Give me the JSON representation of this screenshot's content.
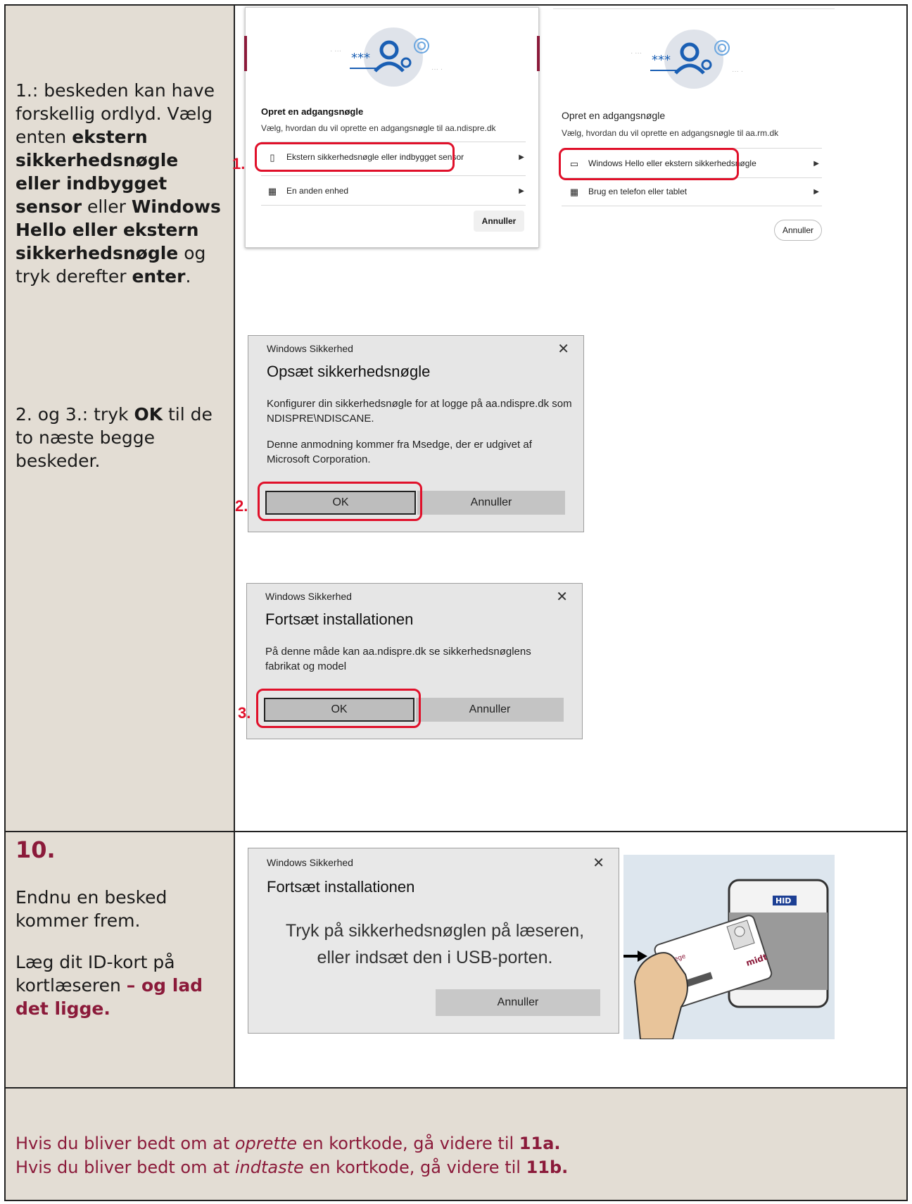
{
  "row1": {
    "left_text": {
      "p1": "1.: beskeden kan have forskellig ordlyd. Vælg enten ",
      "b1": "ekstern sikkerhedsnøgle eller indbygget sensor",
      "p2": " eller ",
      "b2": "Windows Hello eller ekstern sikkerhedsnøgle",
      "p3": " og tryk derefter ",
      "b3": "enter",
      "p4": "."
    },
    "left_text2": {
      "p1": "2. og 3.: tryk ",
      "b1": "OK",
      "p2": " til de to næste begge beskeder."
    },
    "passkey_a": {
      "title": "Opret en adgangsnøgle",
      "subtitle": "Vælg, hvordan du vil oprette en adgangsnøgle til aa.ndispre.dk",
      "option1": "Ekstern sikkerhedsnøgle eller indbygget sensor",
      "option2": "En anden enhed",
      "cancel": "Annuller",
      "marker": "1."
    },
    "passkey_b": {
      "title": "Opret en adgangsnøgle",
      "subtitle": "Vælg, hvordan du vil oprette en adgangsnøgle til aa.rm.dk",
      "option1": "Windows Hello eller ekstern sikkerhedsnøgle",
      "option2": "Brug en telefon eller tablet",
      "cancel": "Annuller"
    },
    "dialog2": {
      "header": "Windows Sikkerhed",
      "title": "Opsæt sikkerhedsnøgle",
      "body1": "Konfigurer din sikkerhedsnøgle for at logge på aa.ndispre.dk som NDISPRE\\NDISCANE.",
      "body2": "Denne anmodning kommer fra Msedge, der er udgivet af Microsoft Corporation.",
      "ok": "OK",
      "cancel": "Annuller",
      "marker": "2."
    },
    "dialog3": {
      "header": "Windows Sikkerhed",
      "title": "Fortsæt installationen",
      "body1": "På denne måde kan aa.ndispre.dk se sikkerhedsnøglens fabrikat og model",
      "ok": "OK",
      "cancel": "Annuller",
      "marker": "3."
    }
  },
  "row2": {
    "step": "10.",
    "text1": "Endnu en besked kommer frem.",
    "text2a": "Læg dit ID-kort på kortlæseren ",
    "text2b": "– og lad det ligge.",
    "dialog": {
      "header": "Windows Sikkerhed",
      "title": "Fortsæt installationen",
      "body": "Tryk på sikkerhedsnøglen på læseren, eller indsæt den i USB-porten.",
      "cancel": "Annuller"
    },
    "card": {
      "label": "Læge",
      "brand": "midt",
      "reader_brand": "HID"
    }
  },
  "row3": {
    "line1a": "Hvis du bliver bedt om at ",
    "line1b": "oprette",
    "line1c": " en kortkode, gå videre til ",
    "line1d": "11a.",
    "line2a": "Hvis du bliver bedt om at ",
    "line2b": "indtaste",
    "line2c": " en kortkode, gå videre til ",
    "line2d": "11b."
  },
  "colors": {
    "accent": "#8b1a3a",
    "highlight": "#e0102a",
    "cell_bg": "#e3ddd4"
  }
}
